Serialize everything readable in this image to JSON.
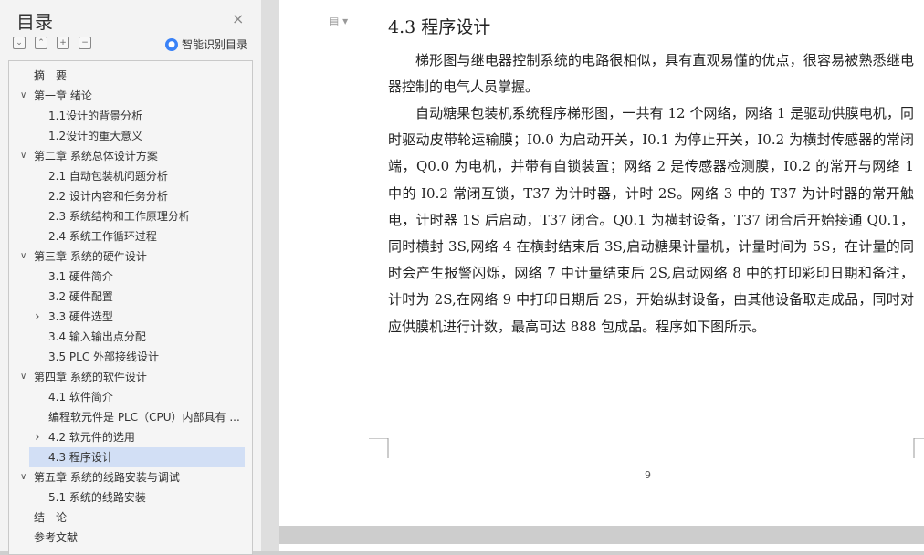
{
  "sidebar": {
    "title": "目录",
    "close_glyph": "×",
    "smart_label": "智能识别目录",
    "toc": [
      {
        "label": "摘　要",
        "level": 0,
        "chev": ""
      },
      {
        "label": "第一章 绪论",
        "level": 0,
        "chev": "down"
      },
      {
        "label": "1.1设计的背景分析",
        "level": 1,
        "chev": ""
      },
      {
        "label": "1.2设计的重大意义",
        "level": 1,
        "chev": ""
      },
      {
        "label": "第二章 系统总体设计方案",
        "level": 0,
        "chev": "down"
      },
      {
        "label": "2.1 自动包装机问题分析",
        "level": 1,
        "chev": ""
      },
      {
        "label": "2.2 设计内容和任务分析",
        "level": 1,
        "chev": ""
      },
      {
        "label": "2.3 系统结构和工作原理分析",
        "level": 1,
        "chev": ""
      },
      {
        "label": "2.4 系统工作循环过程",
        "level": 1,
        "chev": ""
      },
      {
        "label": "第三章 系统的硬件设计",
        "level": 0,
        "chev": "down"
      },
      {
        "label": "3.1 硬件简介",
        "level": 1,
        "chev": ""
      },
      {
        "label": "3.2 硬件配置",
        "level": 1,
        "chev": ""
      },
      {
        "label": "3.3 硬件选型",
        "level": 1,
        "chev": "right"
      },
      {
        "label": "3.4 输入输出点分配",
        "level": 1,
        "chev": ""
      },
      {
        "label": "3.5 PLC 外部接线设计",
        "level": 1,
        "chev": ""
      },
      {
        "label": "第四章 系统的软件设计",
        "level": 0,
        "chev": "down"
      },
      {
        "label": "4.1 软件简介",
        "level": 1,
        "chev": ""
      },
      {
        "label": "编程软元件是 PLC（CPU）内部具有 ...",
        "level": 1,
        "chev": ""
      },
      {
        "label": "4.2 软元件的选用",
        "level": 1,
        "chev": "right"
      },
      {
        "label": "4.3 程序设计",
        "level": 1,
        "chev": "",
        "active": true
      },
      {
        "label": "第五章 系统的线路安装与调试",
        "level": 0,
        "chev": "down"
      },
      {
        "label": "5.1 系统的线路安装",
        "level": 1,
        "chev": ""
      },
      {
        "label": "结　论",
        "level": 0,
        "chev": ""
      },
      {
        "label": "参考文献",
        "level": 0,
        "chev": ""
      }
    ]
  },
  "document": {
    "heading": "4.3 程序设计",
    "paragraphs": [
      "梯形图与继电器控制系统的电路很相似，具有直观易懂的优点，很容易被熟悉继电器控制的电气人员掌握。",
      "自动糖果包装机系统程序梯形图，一共有 12 个网络，网络 1 是驱动供膜电机，同时驱动皮带轮运输膜；I0.0 为启动开关，I0.1 为停止开关，I0.2 为横封传感器的常闭端，Q0.0 为电机，并带有自锁装置；网络 2 是传感器检测膜，I0.2 的常开与网络 1 中的 I0.2 常闭互锁，T37 为计时器，计时 2S。网络 3 中的 T37 为计时器的常开触电，计时器 1S 后启动，T37 闭合。Q0.1 为横封设备，T37 闭合后开始接通 Q0.1，同时横封 3S,网络 4 在横封结束后 3S,启动糖果计量机，计量时间为 5S，在计量的同时会产生报警闪烁，网络 7 中计量结束后 2S,启动网络 8 中的打印彩印日期和备注，计时为 2S,在网络 9 中打印日期后 2S，开始纵封设备，由其他设备取走成品，同时对应供膜机进行计数，最高可达 888 包成品。程序如下图所示。"
    ],
    "page_number": "9"
  }
}
